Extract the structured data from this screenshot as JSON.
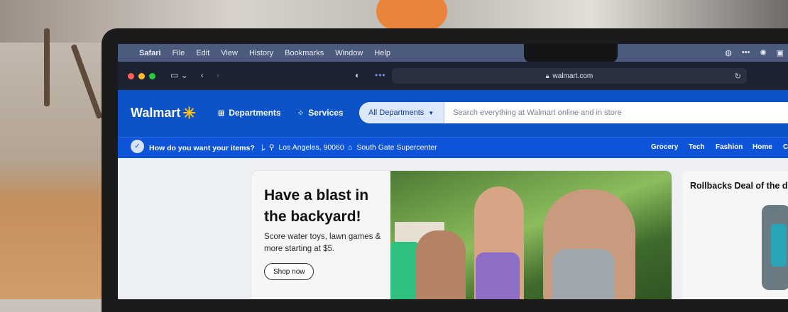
{
  "menubar": {
    "apple": "",
    "items": [
      "Safari",
      "File",
      "Edit",
      "View",
      "History",
      "Bookmarks",
      "Window",
      "Help"
    ]
  },
  "toolbar": {
    "url": "walmart.com",
    "traffic_colors": [
      "#fe5f57",
      "#febc2e",
      "#28c840"
    ]
  },
  "header": {
    "logo": "Walmart",
    "departments_label": "Departments",
    "services_label": "Services",
    "search_dept_label": "All Departments",
    "search_placeholder": "Search everything at Walmart online and in store"
  },
  "location_bar": {
    "question": "How do you want your items?",
    "location": "Los Angeles, 90060",
    "store": "South Gate Supercenter",
    "categories": [
      "Grocery",
      "Tech",
      "Fashion",
      "Home",
      "C"
    ]
  },
  "hero": {
    "title": "Have a blast in the backyard!",
    "subtitle": "Score water toys, lawn games & more starting at $5.",
    "button": "Shop now"
  },
  "rollbacks": {
    "title": "Rollbacks Deal of the d"
  },
  "colors": {
    "walmart_blue": "#0b53c6",
    "spark_yellow": "#ffc220"
  }
}
